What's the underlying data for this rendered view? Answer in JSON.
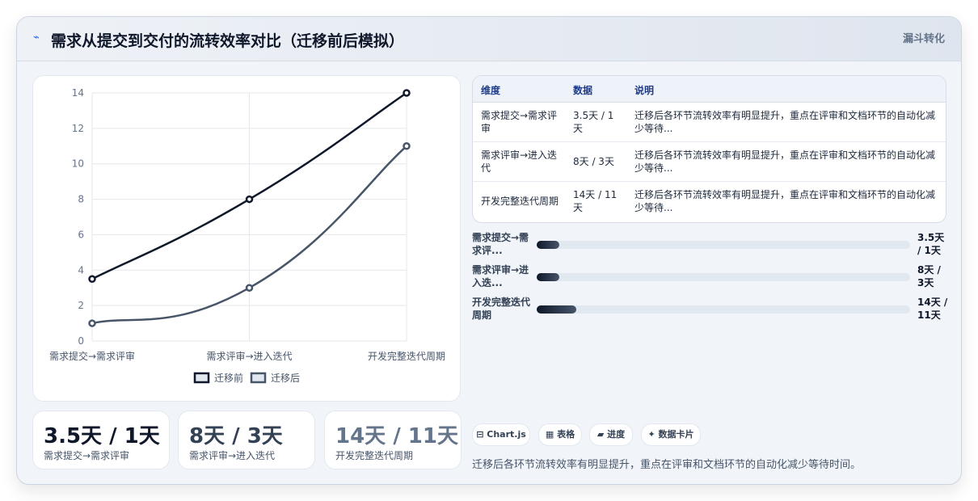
{
  "header": {
    "title": "需求从提交到交付的流转效率对比（迁移前后模拟）",
    "title_icon": "⌁",
    "tag": "漏斗转化"
  },
  "colors": {
    "before": "#0f172a",
    "after": "#475569",
    "accent": "#2563eb"
  },
  "chart_data": {
    "type": "line",
    "categories": [
      "需求提交→需求评审",
      "需求评审→进入迭代",
      "开发完整迭代周期"
    ],
    "series": [
      {
        "name": "迁移前",
        "values": [
          3.5,
          8,
          14
        ]
      },
      {
        "name": "迁移后",
        "values": [
          1,
          3,
          11
        ]
      }
    ],
    "ylim": [
      0,
      14
    ],
    "yticks": [
      "0",
      "2",
      "4",
      "6",
      "8",
      "10",
      "12",
      "14"
    ],
    "grid": true,
    "legend": "bottom"
  },
  "stats": [
    {
      "value": "3.5天 / 1天",
      "label": "需求提交→需求评审"
    },
    {
      "value": "8天 / 3天",
      "label": "需求评审→进入迭代"
    },
    {
      "value": "14天 / 11天",
      "label": "开发完整迭代周期"
    }
  ],
  "table": {
    "headers": [
      "维度",
      "数据",
      "说明"
    ],
    "rows": [
      {
        "dim": "需求提交→需求评审",
        "data": "3.5天 / 1天",
        "note": "迁移后各环节流转效率有明显提升，重点在评审和文档环节的自动化减少等待..."
      },
      {
        "dim": "需求评审→进入迭代",
        "data": "8天 / 3天",
        "note": "迁移后各环节流转效率有明显提升，重点在评审和文档环节的自动化减少等待..."
      },
      {
        "dim": "开发完整迭代周期",
        "data": "14天 / 11天",
        "note": "迁移后各环节流转效率有明显提升，重点在评审和文档环节的自动化减少等待..."
      }
    ]
  },
  "progress": [
    {
      "label": "需求提交→需求评...",
      "value": "3.5天 / 1天",
      "fraction": 0.06
    },
    {
      "label": "需求评审→进入迭...",
      "value": "8天 / 3天",
      "fraction": 0.06
    },
    {
      "label": "开发完整迭代周期",
      "value": "14天 / 11天",
      "fraction": 0.107
    }
  ],
  "pills": [
    {
      "icon": "⊟",
      "label": "Chart.js"
    },
    {
      "icon": "▦",
      "label": "表格"
    },
    {
      "icon": "▰",
      "label": "进度"
    },
    {
      "icon": "✦",
      "label": "数据卡片"
    }
  ],
  "footer": "迁移后各环节流转效率有明显提升，重点在评审和文档环节的自动化减少等待时间。"
}
